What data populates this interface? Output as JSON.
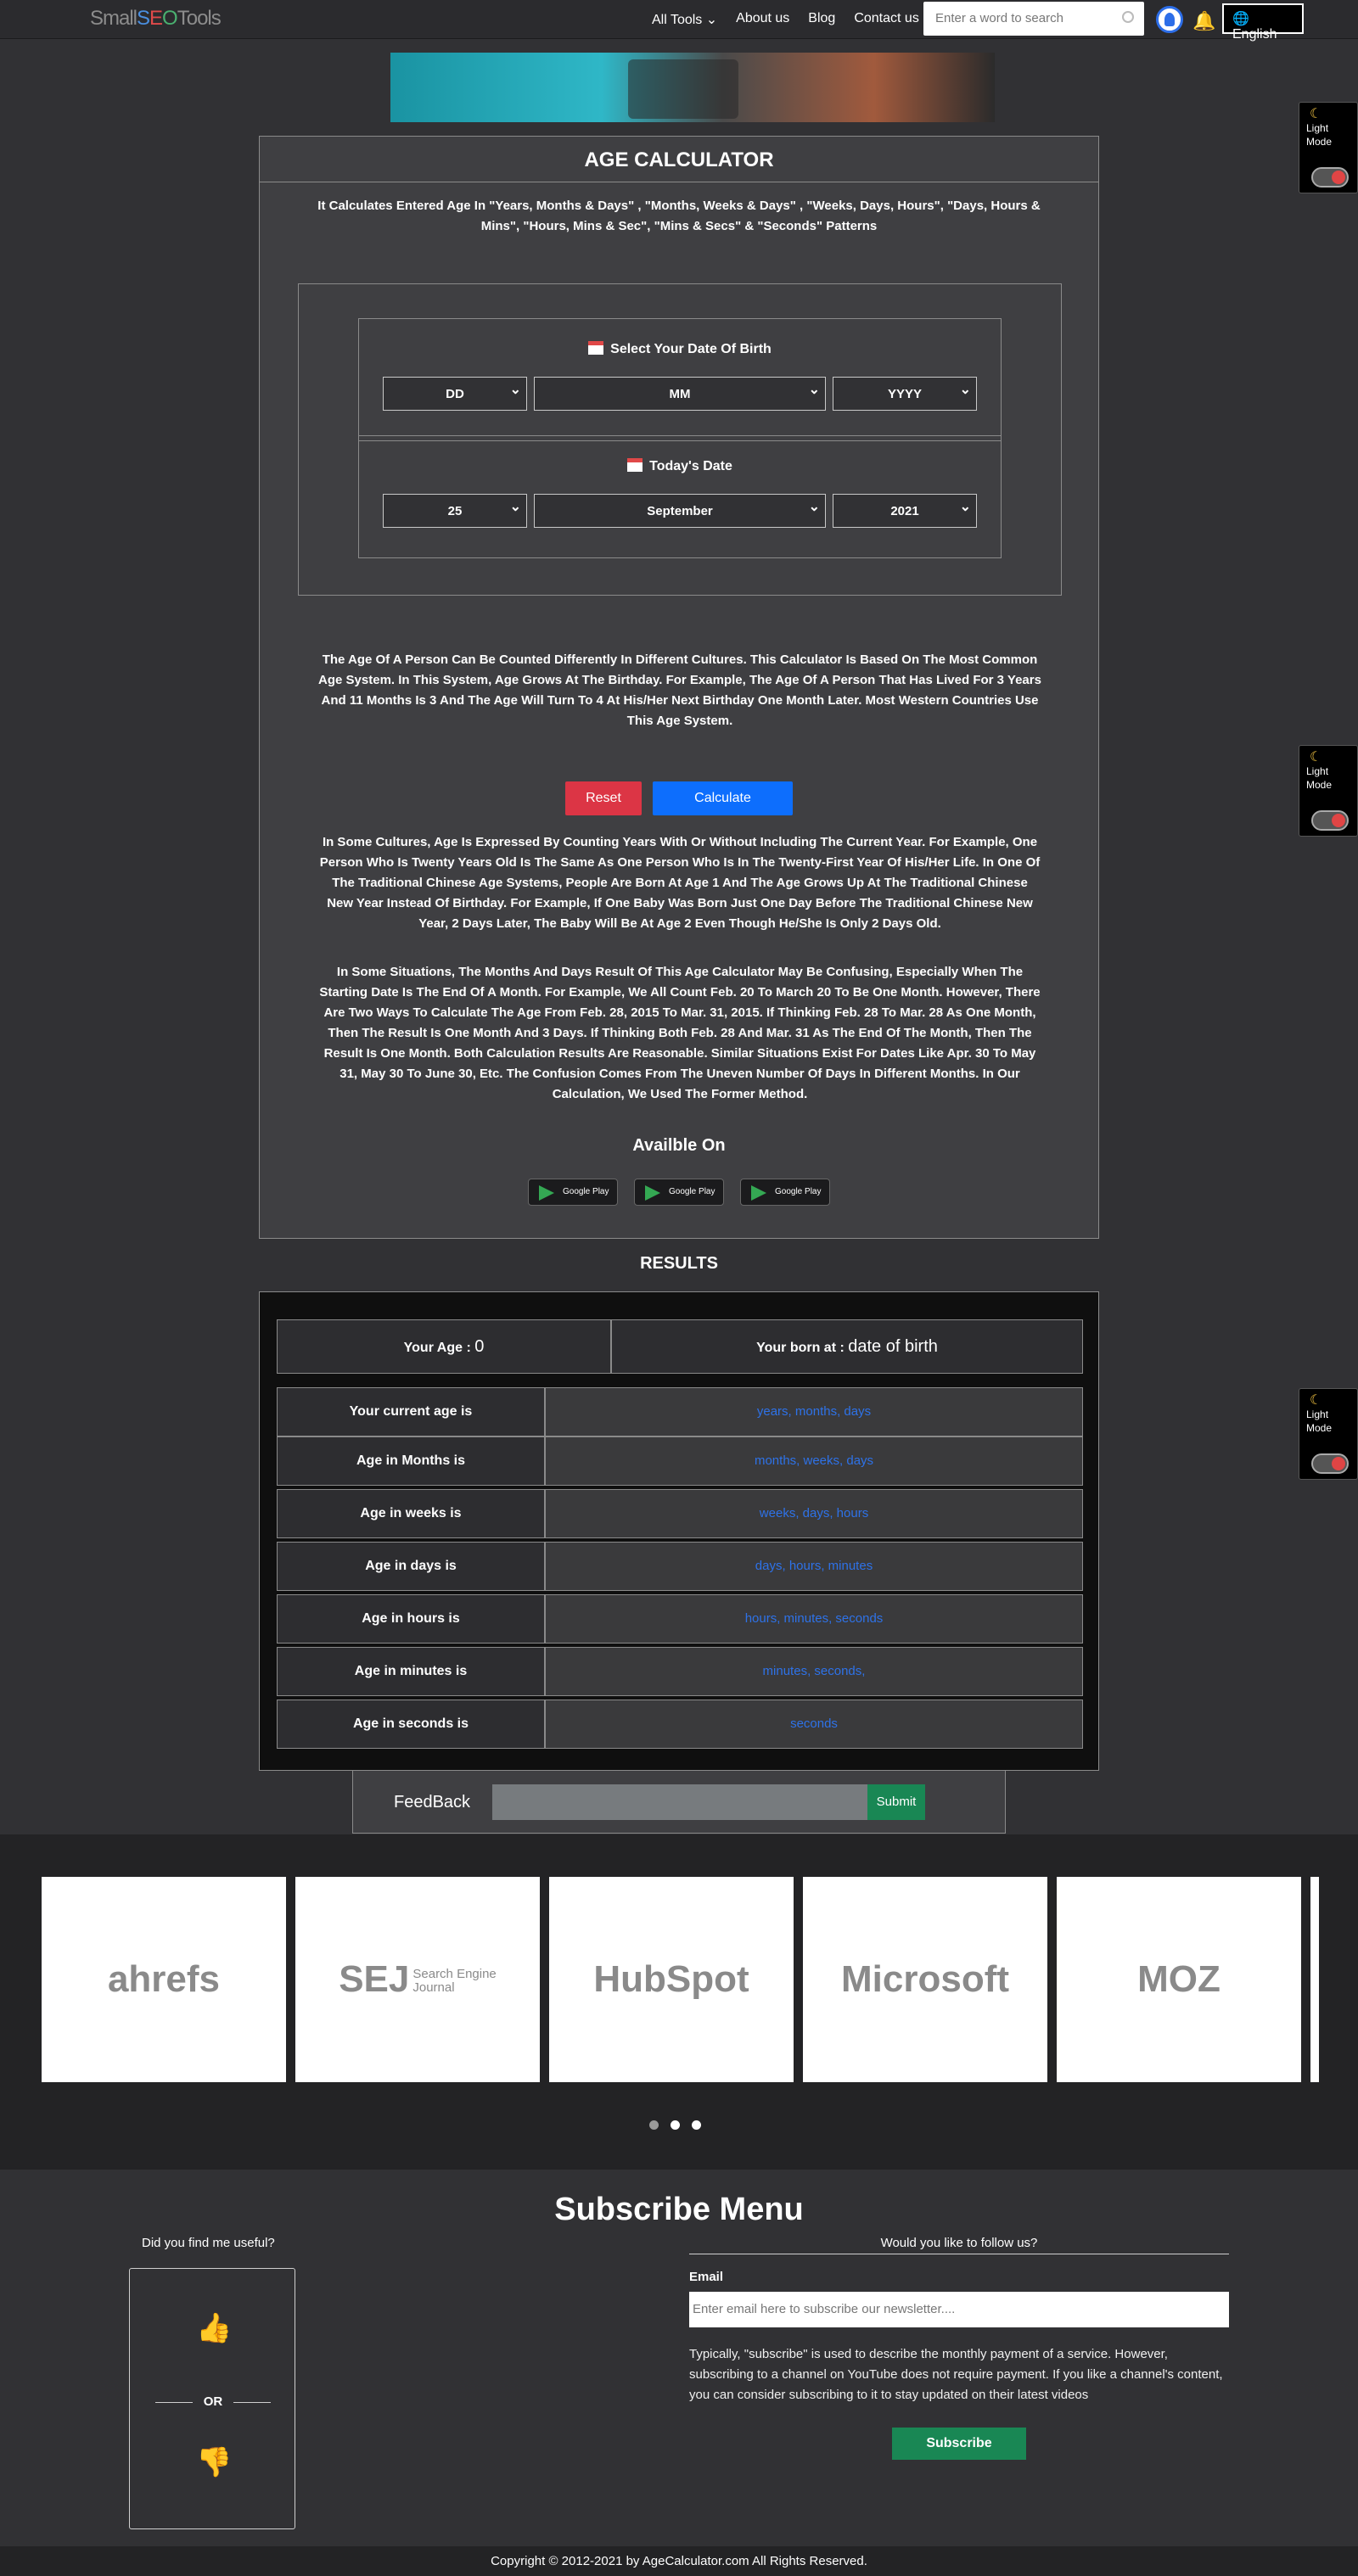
{
  "nav": {
    "logo_parts": [
      "Small",
      "S",
      "E",
      "O",
      "Tools"
    ],
    "links": [
      "All Tools ⌄",
      "About us",
      "Blog",
      "Contact us"
    ],
    "search_placeholder": "Enter a word to search",
    "language": "English"
  },
  "light_mode": {
    "label_1": "Light",
    "label_2": "Mode"
  },
  "calculator": {
    "title": "AGE CALCULATOR",
    "subtitle": "It Calculates Entered Age In \"Years, Months & Days\" , \"Months, Weeks & Days\" , \"Weeks, Days, Hours\", \"Days, Hours & Mins\", \"Hours, Mins & Sec\", \"Mins & Secs\" & \"Seconds\" Patterns",
    "dob_label": "Select Your Date Of Birth",
    "dob": {
      "day": "DD",
      "month": "MM",
      "year": "YYYY"
    },
    "today_label": "Today's Date",
    "today": {
      "day": "25",
      "month": "September",
      "year": "2021"
    },
    "paragraph_1": "The Age Of A Person Can Be Counted Differently In Different Cultures. This Calculator Is Based On The Most Common Age System. In This System, Age Grows At The Birthday. For Example, The Age Of A Person That Has Lived For 3 Years And 11 Months Is 3 And The Age Will Turn To 4 At His/Her Next Birthday One Month Later. Most Western Countries Use This Age System.",
    "reset_label": "Reset",
    "calculate_label": "Calculate",
    "paragraph_2": "In Some Cultures, Age Is Expressed By Counting Years With Or Without Including The Current Year. For Example, One Person Who Is Twenty Years Old Is The Same As One Person Who Is In The Twenty-First Year Of His/Her Life. In One Of The Traditional Chinese Age Systems, People Are Born At Age 1 And The Age Grows Up At The Traditional Chinese New Year Instead Of Birthday. For Example, If One Baby Was Born Just One Day Before The Traditional Chinese New Year, 2 Days Later, The Baby Will Be At Age 2 Even Though He/She Is Only 2 Days Old.",
    "paragraph_3": "In Some Situations, The Months And Days Result Of This Age Calculator May Be Confusing, Especially When The Starting Date Is The End Of A Month. For Example, We All Count Feb. 20 To March 20 To Be One Month. However, There Are Two Ways To Calculate The Age From Feb. 28, 2015 To Mar. 31, 2015. If Thinking Feb. 28 To Mar. 28 As One Month, Then The Result Is One Month And 3 Days. If Thinking Both Feb. 28 And Mar. 31 As The End Of The Month, Then The Result Is One Month. Both Calculation Results Are Reasonable. Similar Situations Exist For Dates Like Apr. 30 To May 31, May 30 To June 30, Etc. The Confusion Comes From The Uneven Number Of Days In Different Months. In Our Calculation, We Used The Former Method.",
    "available_on": "Availble On",
    "store_badge": "Google Play"
  },
  "results": {
    "title": "RESULTS",
    "your_age_label": "Your Age : ",
    "your_age_value": "0",
    "born_at_label": "Your born at : ",
    "born_at_value": "date of birth",
    "rows": [
      {
        "key": "Your current age is",
        "value": "years, months, days"
      },
      {
        "key": "Age in Months is",
        "value": "months, weeks, days"
      },
      {
        "key": "Age in weeks is",
        "value": "weeks, days, hours"
      },
      {
        "key": "Age in days is",
        "value": "days, hours, minutes"
      },
      {
        "key": "Age in hours is",
        "value": "hours, minutes, seconds"
      },
      {
        "key": "Age in minutes is",
        "value": "minutes, seconds,"
      },
      {
        "key": "Age in seconds is",
        "value": "seconds"
      }
    ]
  },
  "feedback": {
    "label": "FeedBack",
    "submit": "Submit"
  },
  "partners": {
    "items": [
      "ahrefs",
      "SEJ",
      "HubSpot",
      "Microsoft",
      "MOZ"
    ],
    "sej_line_1": "Search Engine",
    "sej_line_2": "Journal",
    "active_slide": 2
  },
  "subscribe": {
    "title": "Subscribe Menu",
    "useful_question": "Did you find me useful?",
    "or_label": "OR",
    "follow_question": "Would you like to follow us?",
    "email_label": "Email",
    "email_placeholder": "Enter email here to subscribe our newsletter....",
    "description": "Typically, \"subscribe\" is used to describe the monthly payment of a service. However, subscribing to a channel on YouTube does not require payment. If you like a channel's content, you can consider subscribing to it to stay updated on their latest videos",
    "button": "Subscribe"
  },
  "footer": {
    "copyright": "Copyright © 2012-2021 by AgeCalculator.com All Rights Reserved."
  },
  "colors": {
    "accent_blue": "#0d6efd",
    "reset_red": "#dc3545",
    "submit_green": "#198754",
    "result_value_blue": "#2e72e8"
  }
}
